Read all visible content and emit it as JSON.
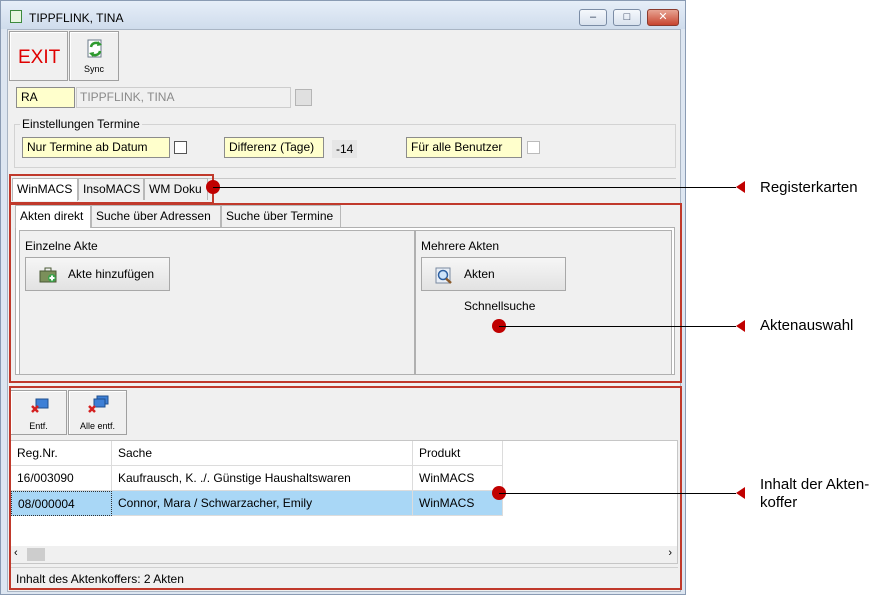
{
  "window": {
    "title": "TIPPFLINK, TINA"
  },
  "toolbar": {
    "exit_label": "EXIT",
    "sync_label": "Sync"
  },
  "header": {
    "code": "RA",
    "name": "TIPPFLINK, TINA"
  },
  "settings": {
    "group_label": "Einstellungen Termine",
    "nur_termine_label": "Nur Termine ab Datum",
    "differenz_label": "Differenz (Tage)",
    "differenz_value": "-14",
    "fuer_alle_label": "Für alle Benutzer"
  },
  "register_tabs": [
    "WinMACS",
    "InsoMACS",
    "WM Doku"
  ],
  "akten_tabs": [
    "Akten direkt",
    "Suche über Adressen",
    "Suche über Termine"
  ],
  "akten_direkt": {
    "einzelne_label": "Einzelne Akte",
    "add_button": "Akte hinzufügen",
    "mehrere_label": "Mehrere Akten",
    "search_button": "Akten Schnellsuche"
  },
  "aktenkoffer": {
    "remove_label": "Entf.",
    "remove_all_label": "Alle entf.",
    "columns": [
      "Reg.Nr.",
      "Sache",
      "Produkt"
    ],
    "rows": [
      [
        "16/003090",
        "Kaufrausch, K. ./. Günstige Haushaltswaren",
        "WinMACS"
      ],
      [
        "08/000004",
        "Connor, Mara / Schwarzacher, Emily",
        "WinMACS"
      ]
    ],
    "status": "Inhalt des Aktenkoffers:  2 Akten"
  },
  "annotations": {
    "registerkarten": "Registerkarten",
    "aktenauswahl": "Aktenauswahl",
    "inhalt_line1": "Inhalt der Akten-",
    "inhalt_line2": "koffer"
  },
  "colors": {
    "annotation_red": "#c00000",
    "selected_row": "#a9d7f6",
    "field_yellow": "#ffffcc"
  }
}
